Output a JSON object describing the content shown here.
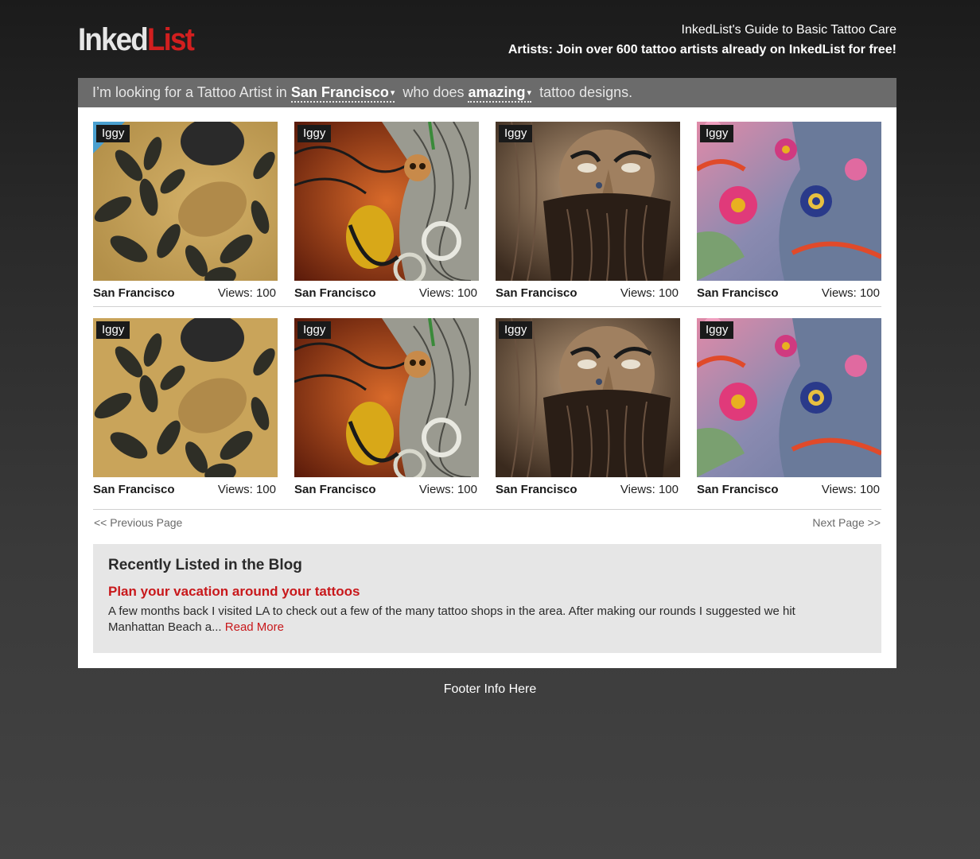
{
  "header": {
    "logo_part1": "Inked",
    "logo_part2": "List",
    "guide_link": "InkedList's Guide to Basic Tattoo Care",
    "join_link": "Artists: Join over 600 tattoo artists already on InkedList for free!"
  },
  "search": {
    "prefix": "I’m looking for a Tattoo Artist in",
    "city": "San Francisco",
    "middle": "who does",
    "style": "amazing",
    "suffix": "tattoo designs.",
    "caret": "▾"
  },
  "listings": [
    {
      "artist": "Iggy",
      "city": "San Francisco",
      "views": "Views: 100",
      "image": "leaves-tattoo"
    },
    {
      "artist": "Iggy",
      "city": "San Francisco",
      "views": "Views: 100",
      "image": "skull-waves-tattoo"
    },
    {
      "artist": "Iggy",
      "city": "San Francisco",
      "views": "Views: 100",
      "image": "bearded-face-tattoo"
    },
    {
      "artist": "Iggy",
      "city": "San Francisco",
      "views": "Views: 100",
      "image": "flower-elephant-tattoo"
    },
    {
      "artist": "Iggy",
      "city": "San Francisco",
      "views": "Views: 100",
      "image": "leaves-tattoo"
    },
    {
      "artist": "Iggy",
      "city": "San Francisco",
      "views": "Views: 100",
      "image": "skull-waves-tattoo"
    },
    {
      "artist": "Iggy",
      "city": "San Francisco",
      "views": "Views: 100",
      "image": "bearded-face-tattoo"
    },
    {
      "artist": "Iggy",
      "city": "San Francisco",
      "views": "Views: 100",
      "image": "flower-elephant-tattoo"
    }
  ],
  "pagination": {
    "prev": "<< Previous Page",
    "next": "Next Page >>"
  },
  "blog": {
    "heading": "Recently Listed in the Blog",
    "post_title": "Plan your vacation around your tattoos",
    "excerpt": "A few months back I visited LA to check out a few of the many tattoo shops in the area.   After making our rounds I suggested we hit Manhattan Beach a...",
    "read_more": "Read More"
  },
  "footer": {
    "text": "Footer Info Here"
  },
  "colors": {
    "accent_red": "#d21f1f",
    "search_bar": "#6b6b6b",
    "blog_bg": "#e6e6e6"
  }
}
